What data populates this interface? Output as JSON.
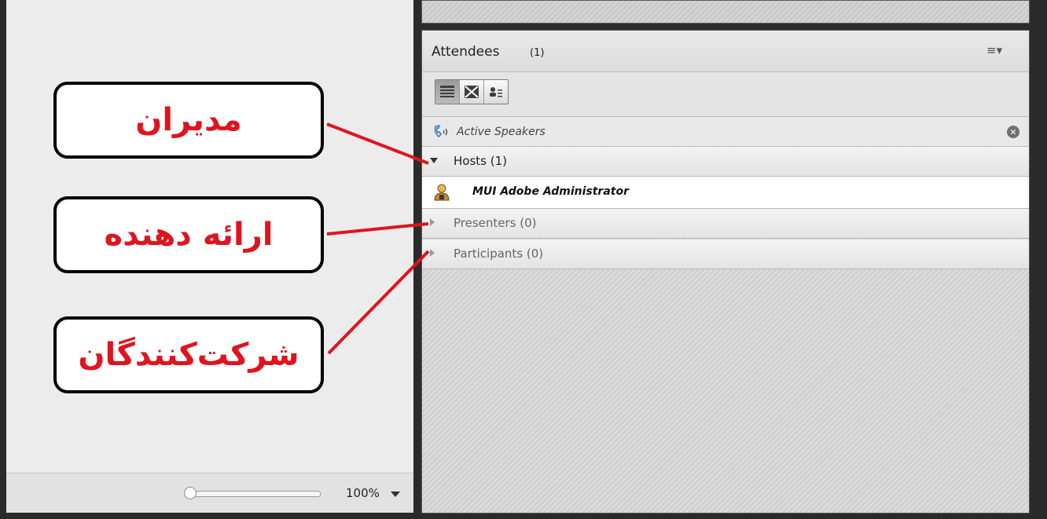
{
  "stage": {
    "zoom": {
      "label": "100%",
      "level": 0.0
    }
  },
  "annotations": {
    "hosts": "مدیران",
    "presenters": "ارائه دهنده",
    "participants": "شرکت‌کنندگان",
    "color": "#e0141e"
  },
  "attendees": {
    "title": "Attendees",
    "count": "(1)",
    "menu_icon": "≡▾",
    "views": [
      {
        "name": "list-view",
        "active": true
      },
      {
        "name": "grid-view",
        "active": false
      },
      {
        "name": "status-view",
        "active": false
      }
    ],
    "active_speakers": {
      "label": "Active Speakers",
      "close": "✕"
    },
    "sections": {
      "hosts": "Hosts (1)",
      "presenters": "Presenters (0)",
      "participants": "Participants (0)"
    },
    "host_users": [
      {
        "name": "MUI Adobe Administrator"
      }
    ]
  }
}
